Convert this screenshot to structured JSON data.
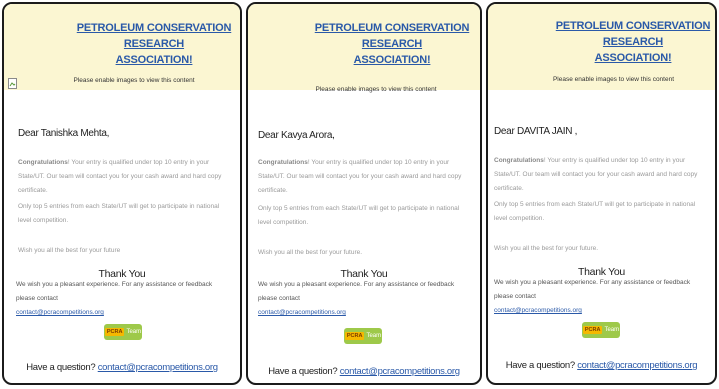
{
  "panels": [
    {
      "org_line1": "PETROLEUM CONSERVATION RESEARCH",
      "org_line2": "ASSOCIATION!",
      "enable_images": "Please enable images to view this content",
      "greeting": "Dear Tanishka Mehta,",
      "congrats_bold": "Congratulations",
      "congrats_rest": "! Your entry is qualified under top 10 entry in your State/UT. Our team will contact you for your cash award and hard copy certificate.",
      "top_entries": "Only top 5 entries from each State/UT will get to participate in national level competition.",
      "wish": "Wish you all the best for your future",
      "thank_you": "Thank You",
      "pleasant_text": "We wish you a pleasant experience. For any assistance or feedback please contact",
      "contact_email": "contact@pcracompetitions.org",
      "team_logo": "PCRA",
      "team_label": "Team",
      "question_text": "Have a question?",
      "question_email": "contact@pcracompetitions.org"
    },
    {
      "org_line1": "PETROLEUM CONSERVATION RESEARCH",
      "org_line2": "ASSOCIATION!",
      "enable_images": "Please enable images to view this content",
      "greeting": "Dear Kavya Arora,",
      "congrats_bold": "Congratulations",
      "congrats_rest": "! Your entry is qualified under top 10 entry in your State/UT. Our team will contact you for your cash award and hard copy certificate.",
      "top_entries": "Only top 5 entries from each State/UT will get to participate in national level competition.",
      "wish": "Wish you all the best for your future.",
      "thank_you": "Thank You",
      "pleasant_text": "We wish you a pleasant experience. For any assistance or feedback please contact",
      "contact_email": "contact@pcracompetitions.org",
      "team_logo": "PCRA",
      "team_label": "Team",
      "question_text": "Have a question?",
      "question_email": "contact@pcracompetitions.org"
    },
    {
      "org_line1": "PETROLEUM CONSERVATION RESEARCH",
      "org_line2": "ASSOCIATION!",
      "enable_images": "Please enable images to view this content",
      "greeting": "Dear DAVITA JAIN ,",
      "congrats_bold": "Congratulations",
      "congrats_rest": "! Your entry is qualified under top 10 entry in your State/UT. Our team will contact you for your cash award and hard copy certificate.",
      "top_entries": "Only top 5 entries from each State/UT will get to participate in national level competition.",
      "wish": "Wish you all the best for your future.",
      "thank_you": "Thank You",
      "pleasant_text": "We wish you a pleasant experience. For any assistance or feedback please contact",
      "contact_email": "contact@pcracompetitions.org",
      "team_logo": "PCRA",
      "team_label": "Team",
      "question_text": "Have a question?",
      "question_email": "contact@pcracompetitions.org"
    }
  ],
  "colors": {
    "header_bg": "#fbf6d2",
    "link": "#2a59a8",
    "team_button": "#9ec94a",
    "panel_border": "#1b1b1b"
  }
}
